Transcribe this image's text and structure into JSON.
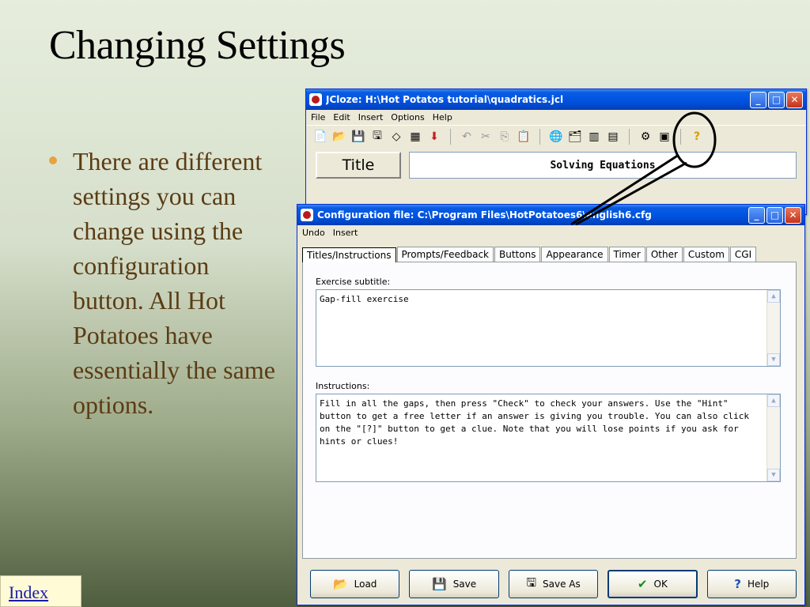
{
  "slide": {
    "title": "Changing Settings",
    "bullet": "There are different settings you can change using the configuration button.  All Hot Potatoes have essentially the same options.",
    "index_link": "Index"
  },
  "colors": {
    "bullet_text": "#5b3c14",
    "bullet_dot": "#e8a33c",
    "xp_titlebar": "#0054e3",
    "xp_window_bg": "#ece9d8"
  },
  "jcloze": {
    "title": "JCloze: H:\\Hot Potatos tutorial\\quadratics.jcl",
    "menu": [
      "File",
      "Edit",
      "Insert",
      "Options",
      "Help"
    ],
    "title_label": "Title",
    "title_value": "Solving Equations",
    "toolbar_icons": [
      "new-file-icon",
      "open-folder-icon",
      "save-icon",
      "save-as-icon",
      "eraser-icon",
      "grid-icon",
      "down-arrow-icon",
      "undo-icon",
      "cut-icon",
      "copy-icon",
      "paste-icon",
      "web-export-icon",
      "folder-export-icon",
      "gap-icon",
      "delete-gap-icon",
      "configuration-icon",
      "color-icon",
      "help-icon"
    ]
  },
  "config": {
    "title": "Configuration file: C:\\Program Files\\HotPotatoes6\\english6.cfg",
    "menu": [
      "Undo",
      "Insert"
    ],
    "tabs": [
      "Titles/Instructions",
      "Prompts/Feedback",
      "Buttons",
      "Appearance",
      "Timer",
      "Other",
      "Custom",
      "CGI"
    ],
    "subtitle_label": "Exercise subtitle:",
    "subtitle_value": "Gap-fill exercise",
    "instructions_label": "Instructions:",
    "instructions_value": "Fill in all the gaps, then press \"Check\" to check your answers. Use the \"Hint\" button to get a free letter if an answer is giving you trouble. You can also click on the \"[?]\" button to get a clue. Note that you will lose points if you ask for hints or clues!",
    "buttons": {
      "load": "Load",
      "save": "Save",
      "save_as": "Save As",
      "ok": "OK",
      "help": "Help"
    }
  }
}
